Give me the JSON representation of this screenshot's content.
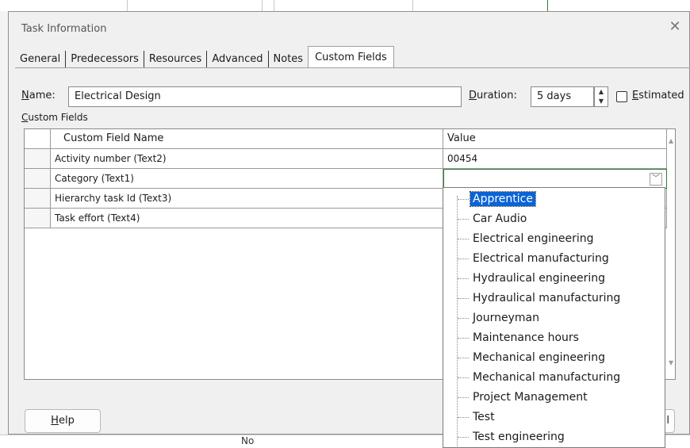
{
  "dialog": {
    "title": "Task Information",
    "close_glyph": "✕",
    "tabs": [
      {
        "label": "General"
      },
      {
        "label": "Predecessors"
      },
      {
        "label": "Resources"
      },
      {
        "label": "Advanced"
      },
      {
        "label": "Notes"
      },
      {
        "label": "Custom Fields",
        "active": true
      }
    ],
    "name": {
      "label_prefix": "",
      "label_mnemonic": "N",
      "label_rest": "ame:",
      "value": "Electrical Design"
    },
    "duration": {
      "label_mnemonic": "D",
      "label_rest": "uration:",
      "value": "5 days"
    },
    "estimated": {
      "label_mnemonic": "E",
      "label_rest": "stimated",
      "checked": false
    },
    "custom_fields_label": {
      "mnemonic": "C",
      "rest": "ustom Fields"
    },
    "grid": {
      "headers": {
        "name": "Custom Field Name",
        "value": "Value"
      },
      "rows": [
        {
          "name": "Activity number (Text2)",
          "value": "00454"
        },
        {
          "name": "Category (Text1)",
          "value": ""
        },
        {
          "name": "Hierarchy task Id (Text3)",
          "value": ""
        },
        {
          "name": "Task effort (Text4)",
          "value": ""
        }
      ]
    },
    "help_button": {
      "mnemonic": "H",
      "rest": "elp"
    },
    "cut_button_text": "l"
  },
  "dropdown": {
    "selected": "Apprentice",
    "options": [
      "Apprentice",
      "Car Audio",
      "Electrical engineering",
      "Electrical manufacturing",
      "Hydraulical engineering",
      "Hydraulical manufacturing",
      "Journeyman",
      "Maintenance hours",
      "Mechanical engineering",
      "Mechanical manufacturing",
      "Project Management",
      "Test",
      "Test engineering"
    ]
  },
  "background": {
    "bottom_text": "No"
  },
  "colors": {
    "accent": "#0a64d6",
    "active_cell_border": "#2e7d32"
  }
}
